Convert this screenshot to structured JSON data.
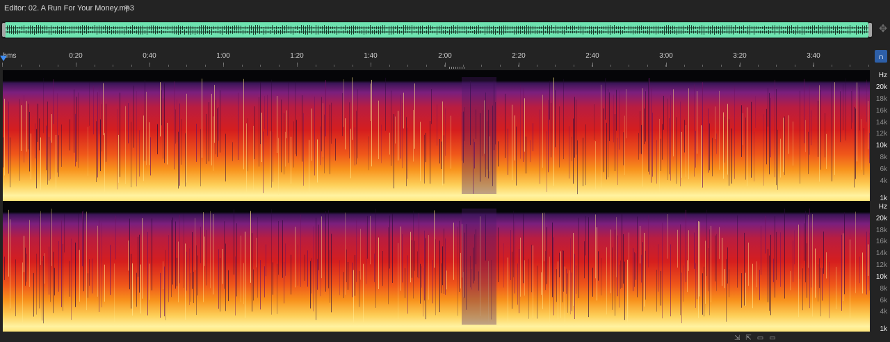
{
  "editor": {
    "title": "Editor: 02. A Run For Your Money.mp3",
    "menu_icon": "hamburger-menu-icon"
  },
  "overview": {
    "waveform_color": "#6ee3b0",
    "zoom_nav_icon": "zoom-navigator-icon"
  },
  "ruler": {
    "ticks": [
      "hms",
      "0:20",
      "0:40",
      "1:00",
      "1:20",
      "1:40",
      "2:00",
      "2:20",
      "2:40",
      "3:00",
      "3:20",
      "3:40"
    ],
    "snap_icon": "magnet-snap-icon"
  },
  "channels": [
    {
      "hz_label": "Hz",
      "freq_labels": [
        "20k",
        "18k",
        "16k",
        "14k",
        "12k",
        "10k",
        "8k",
        "6k",
        "4k",
        "1k"
      ]
    },
    {
      "hz_label": "Hz",
      "freq_labels": [
        "20k",
        "18k",
        "16k",
        "14k",
        "12k",
        "10k",
        "8k",
        "6k",
        "4k",
        "1k"
      ]
    }
  ],
  "colors": {
    "accent": "#3f8ef5",
    "panel_bg": "#232323"
  }
}
